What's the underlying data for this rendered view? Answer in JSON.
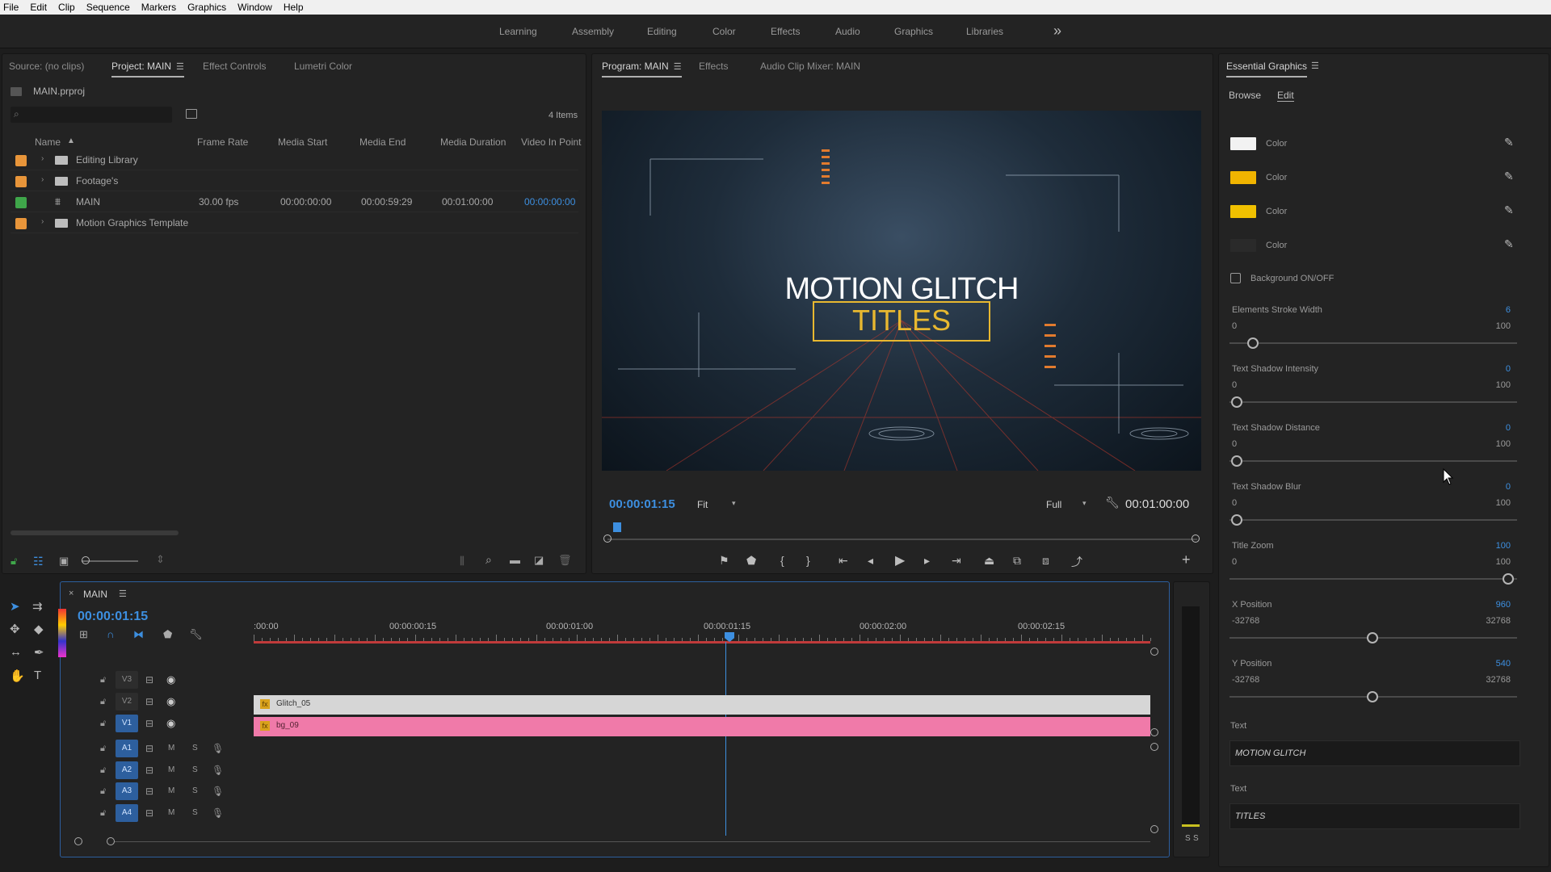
{
  "menu": [
    "File",
    "Edit",
    "Clip",
    "Sequence",
    "Markers",
    "Graphics",
    "Window",
    "Help"
  ],
  "workspaces": [
    "Learning",
    "Assembly",
    "Editing",
    "Color",
    "Effects",
    "Audio",
    "Graphics",
    "Libraries"
  ],
  "more_workspaces": "»",
  "project_panel": {
    "tabs": [
      "Source: (no clips)",
      "Project: MAIN",
      "Effect Controls",
      "Lumetri Color"
    ],
    "project_file": "MAIN.prproj",
    "item_count": "4 Items",
    "columns": [
      "Name",
      "Frame Rate",
      "Media Start",
      "Media End",
      "Media Duration",
      "Video In Point"
    ],
    "rows": [
      {
        "name": "Editing Library",
        "color": "#e8953a",
        "type": "folder",
        "frame_rate": "",
        "media_start": "",
        "media_end": "",
        "media_duration": "",
        "video_in": ""
      },
      {
        "name": "Footage's",
        "color": "#e8953a",
        "type": "folder",
        "frame_rate": "",
        "media_start": "",
        "media_end": "",
        "media_duration": "",
        "video_in": ""
      },
      {
        "name": "MAIN",
        "color": "#3fa64a",
        "type": "sequence",
        "frame_rate": "30.00 fps",
        "media_start": "00:00:00:00",
        "media_end": "00:00:59:29",
        "media_duration": "00:01:00:00",
        "video_in": "00:00:00:00"
      },
      {
        "name": "Motion Graphics Template",
        "color": "#e8953a",
        "type": "folder",
        "frame_rate": "",
        "media_start": "",
        "media_end": "",
        "media_duration": "",
        "video_in": ""
      }
    ]
  },
  "program_panel": {
    "tabs": [
      "Program: MAIN",
      "Effects",
      "Audio Clip Mixer: MAIN"
    ],
    "title_line1": "MOTION GLITCH",
    "title_line2": "TITLES",
    "current_time": "00:00:01:15",
    "zoom": "Fit",
    "resolution": "Full",
    "duration": "00:01:00:00"
  },
  "essential_graphics": {
    "title": "Essential Graphics",
    "tabs": [
      "Browse",
      "Edit"
    ],
    "colors": [
      {
        "label": "Color",
        "value": "#f2f2f2"
      },
      {
        "label": "Color",
        "value": "#f0b400"
      },
      {
        "label": "Color",
        "value": "#f0c000"
      },
      {
        "label": "Color",
        "value": "#2a2a2a"
      }
    ],
    "background_toggle": "Background ON/OFF",
    "sliders": [
      {
        "label": "Elements Stroke Width",
        "value": "6",
        "min": "0",
        "max": "100",
        "fraction": 0.06
      },
      {
        "label": "Text Shadow Intensity",
        "value": "0",
        "min": "0",
        "max": "100",
        "fraction": 0
      },
      {
        "label": "Text Shadow Distance",
        "value": "0",
        "min": "0",
        "max": "100",
        "fraction": 0
      },
      {
        "label": "Text Shadow Blur",
        "value": "0",
        "min": "0",
        "max": "100",
        "fraction": 0
      },
      {
        "label": "Title Zoom",
        "value": "100",
        "min": "0",
        "max": "100",
        "fraction": 1
      },
      {
        "label": "X Position",
        "value": "960",
        "min": "-32768",
        "max": "32768",
        "fraction": 0.5
      },
      {
        "label": "Y Position",
        "value": "540",
        "min": "-32768",
        "max": "32768",
        "fraction": 0.5
      }
    ],
    "text_fields": [
      {
        "label": "Text",
        "value": "MOTION GLITCH"
      },
      {
        "label": "Text",
        "value": "TITLES"
      }
    ]
  },
  "timeline": {
    "sequence_name": "MAIN",
    "close": "×",
    "current_time": "00:00:01:15",
    "ruler": [
      ":00:00",
      "00:00:00:15",
      "00:00:01:00",
      "00:00:01:15",
      "00:00:02:00",
      "00:00:02:15"
    ],
    "video_tracks": [
      "V3",
      "V2",
      "V1"
    ],
    "audio_tracks": [
      "A1",
      "A2",
      "A3",
      "A4"
    ],
    "mute": "M",
    "solo": "S",
    "clips": [
      {
        "name": "Glitch_05",
        "track": "V2",
        "color": "#d6d6d6"
      },
      {
        "name": "bg_09",
        "track": "V1",
        "color": "#f07aa9"
      }
    ],
    "meter_labels": [
      "S",
      "S"
    ]
  }
}
